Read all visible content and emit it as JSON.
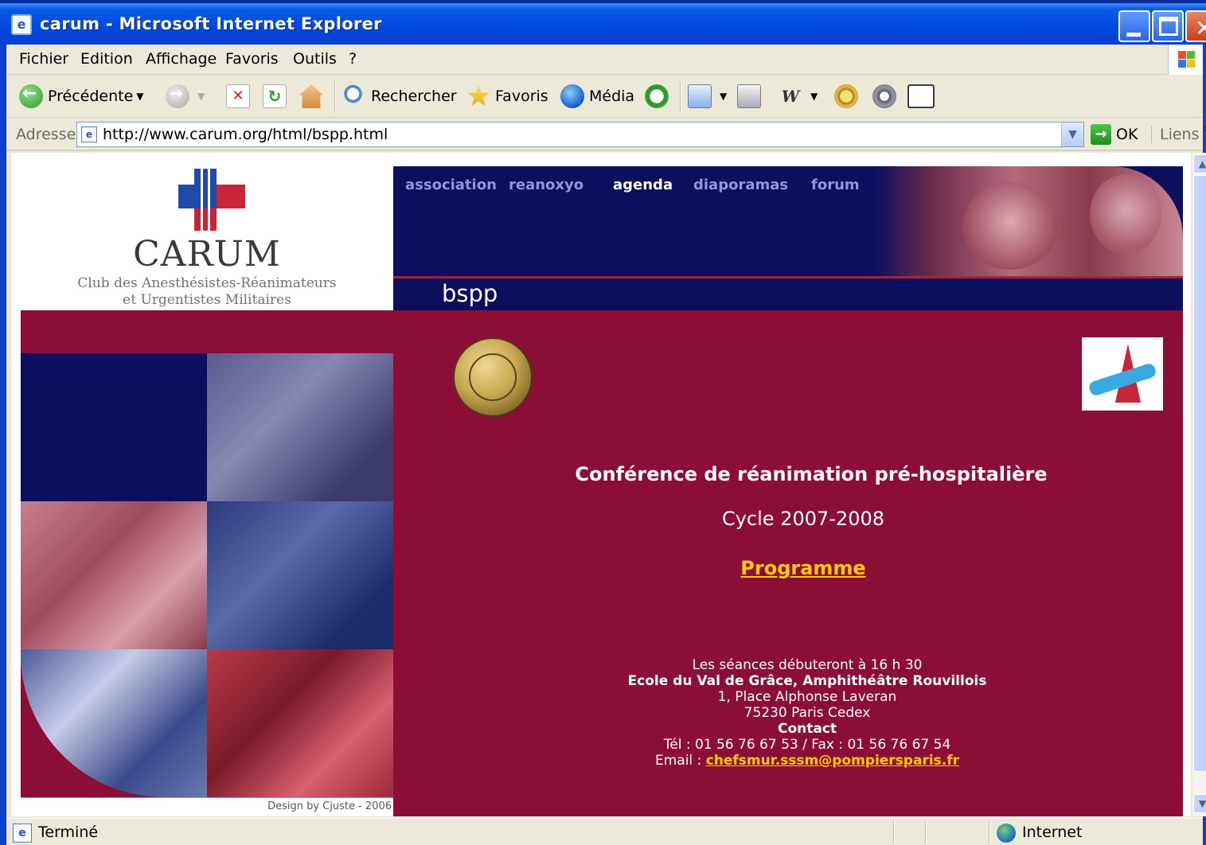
{
  "window": {
    "title": "carum - Microsoft Internet Explorer",
    "title_bar_color": "#0a5ae6"
  },
  "menubar": {
    "items": [
      "Fichier",
      "Edition",
      "Affichage",
      "Favoris",
      "Outils",
      "?"
    ]
  },
  "toolbar": {
    "back_label": "Précédente",
    "search_label": "Rechercher",
    "favorites_label": "Favoris",
    "media_label": "Média",
    "icons": [
      "back-icon",
      "forward-icon",
      "stop-icon",
      "refresh-icon",
      "home-icon",
      "search-icon",
      "favorites-star-icon",
      "media-icon",
      "history-icon",
      "mail-icon",
      "print-icon",
      "word-icon",
      "messenger-icon",
      "settings-icon",
      "edit-icon"
    ]
  },
  "addressbar": {
    "label": "Adresse",
    "url": "http://www.carum.org/html/bspp.html",
    "go_label": "OK",
    "links_label": "Liens",
    "chevron": "»"
  },
  "page": {
    "logo": {
      "name": "CARUM",
      "subtitle_line1": "Club des Anesthésistes-Réanimateurs",
      "subtitle_line2": "et Urgentistes Militaires"
    },
    "nav": {
      "items": [
        "association",
        "reanoxyo",
        "agenda",
        "diaporamas",
        "forum"
      ],
      "active": "agenda"
    },
    "section_title": "bspp",
    "conference_title": "Conférence de réanimation pré-hospitalière",
    "cycle": "Cycle 2007-2008",
    "programme_link": "Programme",
    "info": {
      "start_time": "Les séances débuteront à 16 h 30",
      "venue": "Ecole du Val de Grâce, Amphithéâtre Rouvillois",
      "address_line1": "1, Place Alphonse Laveran",
      "address_line2": "75230 Paris Cedex",
      "contact_heading": "Contact",
      "phone_fax": "Tél : 01 56 76 67 53 / Fax : 01 56 76 67 54",
      "email_label": "Email :",
      "email": "chefsmur.sssm@pompiersparis.fr"
    },
    "design_credit": "Design by Cjuste - 2006",
    "colors": {
      "navy": "#0b0f5e",
      "burgundy": "#8c0e36",
      "link_yellow": "#ffcc00"
    }
  },
  "statusbar": {
    "status": "Terminé",
    "zone": "Internet"
  }
}
